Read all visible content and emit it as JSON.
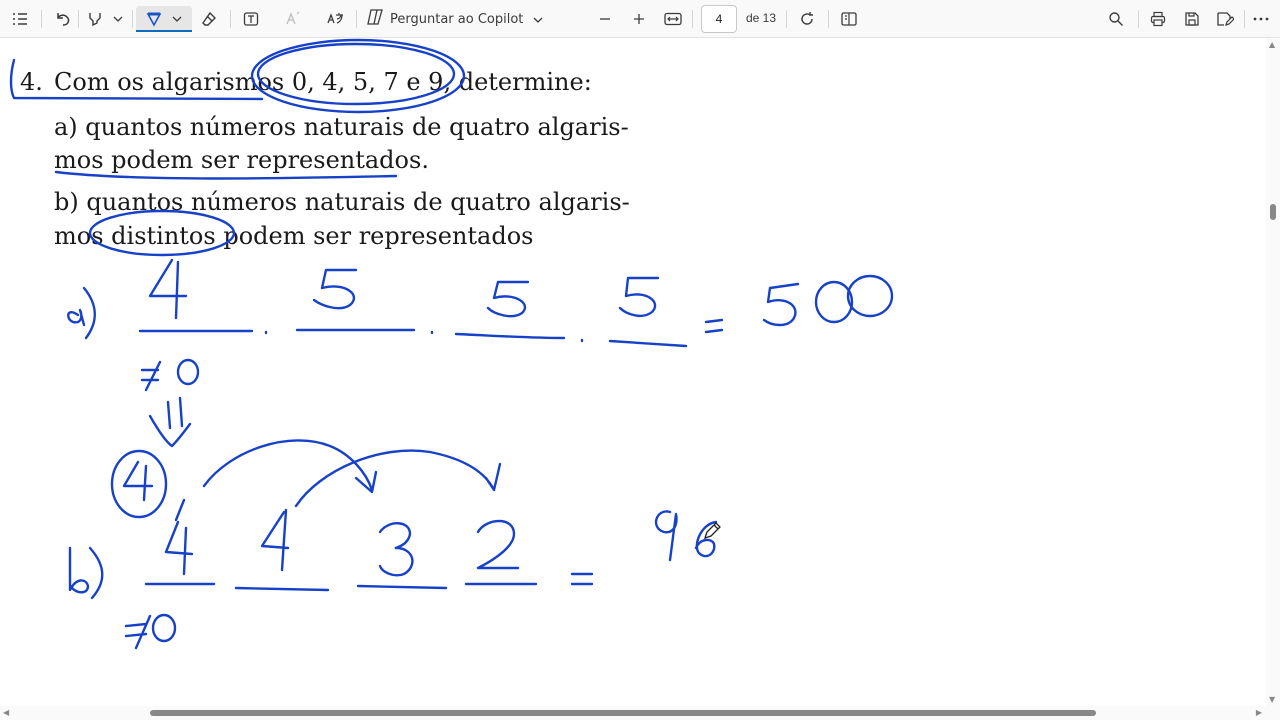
{
  "toolbar": {
    "icons": [
      "contents-icon",
      "undo-icon",
      "highlight-icon",
      "chevron-down-icon",
      "draw-icon",
      "chevron-down-icon",
      "eraser-icon",
      "text-icon",
      "read-aloud-icon",
      "translate-icon",
      "copilot-icon",
      "zoom-out-icon",
      "zoom-in-icon",
      "fit-width-icon",
      "rotate-icon",
      "page-view-icon",
      "search-icon",
      "print-icon",
      "save-icon",
      "save-as-icon",
      "more-icon"
    ],
    "copilot_label": "Perguntar ao Copilot",
    "page_current": "4",
    "page_total": "de 13",
    "accent": "#0f6cbd",
    "ink_color": "#1742c8"
  },
  "document": {
    "problem_number": "4.",
    "problem_text": "Com os algarismos 0, 4, 5, 7 e 9, determine:",
    "item_a_line1": "a) quantos números naturais de quatro algaris-",
    "item_a_line2": "mos podem ser representados.",
    "item_b_line1": "b) quantos números naturais de quatro algaris-",
    "item_b_line2": "mos distintos podem ser representados"
  }
}
